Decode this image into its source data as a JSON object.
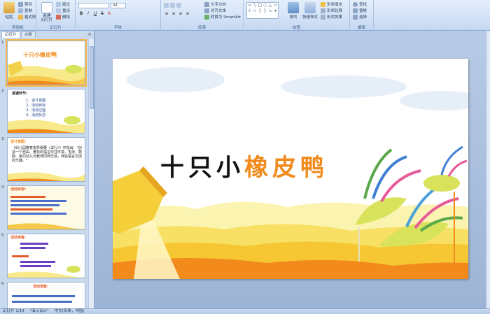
{
  "ribbon": {
    "clipboard": {
      "label": "剪贴板",
      "paste": "粘贴",
      "cut": "剪切",
      "copy": "复制",
      "format_painter": "格式刷"
    },
    "slides": {
      "label": "幻灯片",
      "new_slide": "新建\n幻灯片",
      "layout": "版式",
      "reset": "重设",
      "delete": "删除"
    },
    "font": {
      "label": "字体",
      "size": "44"
    },
    "paragraph": {
      "label": "段落",
      "text_direction": "文字方向",
      "align_text": "对齐文本",
      "smartart": "转换为 SmartArt"
    },
    "drawing": {
      "label": "绘图",
      "arrange": "排列",
      "quick_styles": "快速样式",
      "shape_fill": "形状填充",
      "shape_outline": "形状轮廓",
      "shape_effects": "形状效果"
    },
    "editing": {
      "label": "编辑",
      "find": "查找",
      "replace": "替换",
      "select": "选择"
    }
  },
  "left_pane": {
    "tabs": [
      "幻灯片",
      "大纲"
    ],
    "close": "×",
    "thumbs": [
      {
        "num": "1",
        "text": "十只小橡皮鸭"
      },
      {
        "num": "2",
        "title": "说课环节:",
        "items": [
          "1、设计意图",
          "2、活动目标",
          "3、活动过程",
          "4、活动反思"
        ]
      },
      {
        "num": "3",
        "title": "设计意图:",
        "body": "《幼儿园教育指导纲要（试行）》中指出：\"创造一个自由、宽松的语言交往环境，支持、鼓励、吸引幼儿与教师同伴交谈，体验语言交流的乐趣。\""
      },
      {
        "num": "4",
        "title": "活动目标:"
      },
      {
        "num": "5",
        "title": "活动准备:"
      },
      {
        "num": "6",
        "title": "活动准备:"
      }
    ]
  },
  "slide": {
    "title_black": "十只小",
    "title_orange": "橡皮鸭"
  },
  "status": {
    "slide_info": "幻灯片 1/14",
    "theme": "\"演示设计\"",
    "language": "中文(简体，中国)"
  },
  "colors": {
    "accent": "#f08a1a",
    "ribbon_bg": "#d3e2f6",
    "thumb_text": "#1d3f8f"
  }
}
